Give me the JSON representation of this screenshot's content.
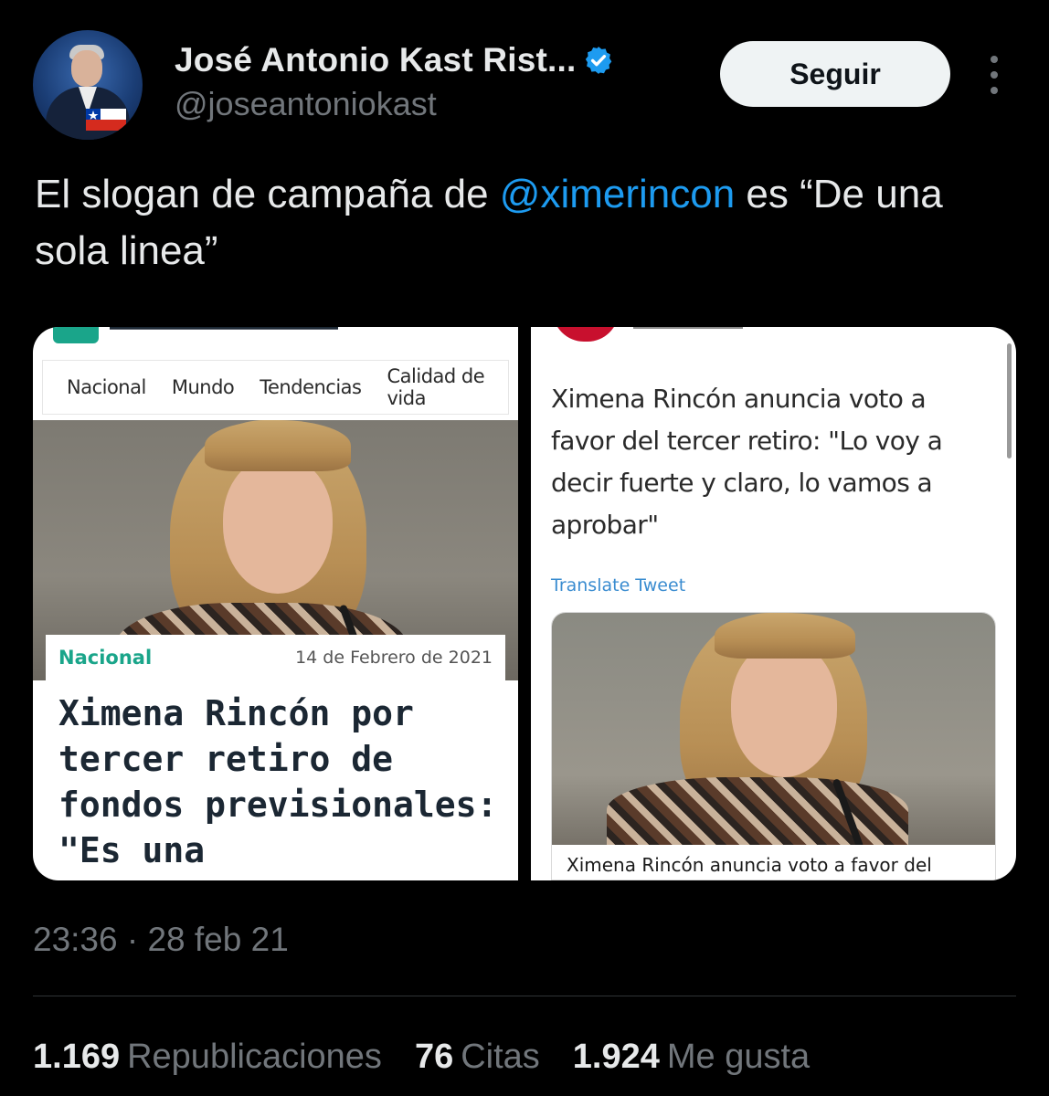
{
  "author": {
    "name": "José Antonio Kast Rist...",
    "handle": "@joseantoniokast",
    "verified": true
  },
  "actions": {
    "follow_label": "Seguir"
  },
  "tweet": {
    "text_before": "El slogan de campaña de ",
    "mention": "@ximerincon",
    "text_after": " es “De una sola linea”",
    "timestamp": "23:36 · 28 feb 21"
  },
  "media_left": {
    "nav": [
      "Nacional",
      "Mundo",
      "Tendencias",
      "Calidad de vida"
    ],
    "section": "Nacional",
    "date": "14 de Febrero de 2021",
    "headline": "Ximena Rincón por tercer retiro de fondos previsionales: \"Es una"
  },
  "media_right": {
    "embed_text": "Ximena Rincón anuncia voto a favor del tercer retiro: \"Lo voy a decir fuerte y claro, lo vamos a aprobar\"",
    "translate_label": "Translate Tweet",
    "card_caption": "Ximena Rincón anuncia voto a favor del"
  },
  "stats": {
    "reposts_count": "1.169",
    "reposts_label": "Republicaciones",
    "quotes_count": "76",
    "quotes_label": "Citas",
    "likes_count": "1.924",
    "likes_label": "Me gusta"
  },
  "colors": {
    "background": "#000000",
    "mention": "#1d9bf0",
    "verified": "#1d9bf0",
    "secondary_text": "#71767b",
    "section_tag": "#1aa58a"
  },
  "icons": [
    "verified-badge-icon",
    "more-options-icon"
  ]
}
